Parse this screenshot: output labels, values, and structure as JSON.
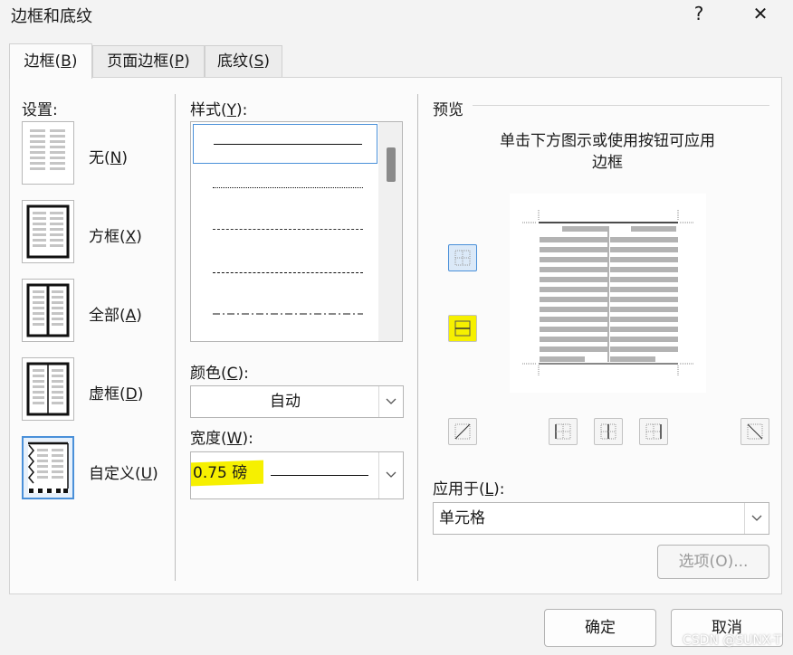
{
  "window": {
    "title": "边框和底纹",
    "help": "?",
    "close": "✕"
  },
  "tabs": [
    {
      "label": "边框(",
      "key": "B",
      "suffix": ")"
    },
    {
      "label": "页面边框(",
      "key": "P",
      "suffix": ")"
    },
    {
      "label": "底纹(",
      "key": "S",
      "suffix": ")"
    }
  ],
  "settings": {
    "title": "设置:",
    "items": [
      {
        "label": "无(",
        "key": "N",
        "suffix": ")"
      },
      {
        "label": "方框(",
        "key": "X",
        "suffix": ")"
      },
      {
        "label": "全部(",
        "key": "A",
        "suffix": ")"
      },
      {
        "label": "虚框(",
        "key": "D",
        "suffix": ")"
      },
      {
        "label": "自定义(",
        "key": "U",
        "suffix": ")"
      }
    ]
  },
  "style": {
    "label": "样式(",
    "key": "Y",
    "suffix": "):"
  },
  "color": {
    "label": "颜色(",
    "key": "C",
    "suffix": "):",
    "value": "自动"
  },
  "width": {
    "label": "宽度(",
    "key": "W",
    "suffix": "):",
    "value": "0.75 磅"
  },
  "preview": {
    "title": "预览",
    "hint_line1": "单击下方图示或使用按钮可应用",
    "hint_line2": "边框"
  },
  "apply": {
    "label": "应用于(",
    "key": "L",
    "suffix": "):",
    "value": "单元格"
  },
  "buttons": {
    "options": "选项(O)...",
    "ok": "确定",
    "cancel": "取消"
  },
  "watermark": "CSDN @SUNX-T",
  "colors": {
    "accent": "#4a90d9",
    "highlight": "#f6f000"
  }
}
